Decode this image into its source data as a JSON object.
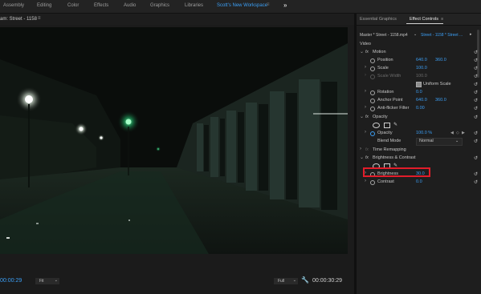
{
  "workspaces": [
    "Assembly",
    "Editing",
    "Color",
    "Effects",
    "Audio",
    "Graphics",
    "Libraries",
    "Scott's New Workspace"
  ],
  "workspace_menu": "≡",
  "more": "»",
  "monitor": {
    "title": "am: Street - 1158",
    "title_menu": "≡",
    "timecode_in": "00:00:29",
    "fit": "Fit",
    "fit_caret": "⌄",
    "resolution": "Full",
    "resolution_caret": "⌄",
    "wrench": "🔧",
    "timecode_out": "00:00:30:29"
  },
  "panel": {
    "tabs": [
      "Essential Graphics",
      "Effect Controls"
    ],
    "active_tab_menu": "≡",
    "master": "Master * Street - 1158.mp4",
    "master_caret": "⌄",
    "clip": "Street - 1158 * Street ...",
    "clip_arrow": "▸",
    "section": "Video",
    "rows": {
      "motion": "Motion",
      "position": {
        "label": "Position",
        "x": "640.0",
        "y": "360.0"
      },
      "scale": {
        "label": "Scale",
        "value": "100.0"
      },
      "scale_width": {
        "label": "Scale Width",
        "value": "100.0"
      },
      "uniform_scale": "Uniform Scale",
      "rotation": {
        "label": "Rotation",
        "value": "0.0"
      },
      "anchor_point": {
        "label": "Anchor Point",
        "x": "640.0",
        "y": "360.0"
      },
      "anti_flicker": {
        "label": "Anti-flicker Filter",
        "value": "0.00"
      },
      "opacity_group": "Opacity",
      "opacity": {
        "label": "Opacity",
        "value": "100.0 %"
      },
      "blend_mode": {
        "label": "Blend Mode",
        "value": "Normal",
        "caret": "⌄"
      },
      "time_remapping": "Time Remapping",
      "brightness_contrast": "Brightness & Contrast",
      "brightness": {
        "label": "Brightness",
        "value": "30.0"
      },
      "contrast": {
        "label": "Contrast",
        "value": "0.0"
      }
    },
    "fx_label": "fx",
    "reset_glyph": "↺",
    "twirl_open": "⌄",
    "twirl_closed": "›",
    "pen_glyph": "✎",
    "kf_left": "◀",
    "kf_diamond": "◇",
    "kf_right": "▶"
  }
}
